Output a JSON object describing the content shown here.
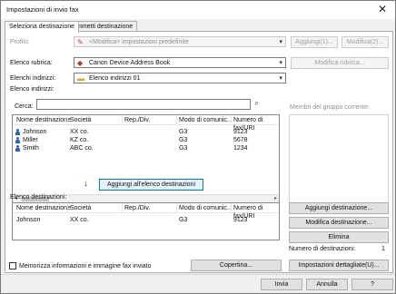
{
  "window": {
    "title": "Impostazioni di invio fax",
    "close_icon": "close-icon"
  },
  "tabs": [
    {
      "label": "Seleziona destinazione"
    },
    {
      "label": "Immetti destinazione"
    }
  ],
  "profile": {
    "label": "Profilo:",
    "value": "<Modifica> impostazioni predefinite",
    "add_button": "Aggiungi(1)...",
    "edit_button": "Modifica(2)..."
  },
  "address_book": {
    "label": "Elenco rubrica:",
    "value": "Canon Device Address Book",
    "edit_button": "Modifica rubrica..."
  },
  "address_list": {
    "label": "Elenchi indirizzi:",
    "value": "Elenco indirizzi 01"
  },
  "indices_label": "Elenco indirizzi:",
  "search": {
    "label": "Cerca:",
    "value": "",
    "icon": "search-icon"
  },
  "group_members_label": "Membri del gruppo corrente:",
  "address_table": {
    "columns": [
      "Nome destinazione",
      "Società",
      "Rep./Div.",
      "Modo di comunic...",
      "Numero di fax/URI"
    ],
    "rows": [
      [
        "Johnson",
        "XX co.",
        "",
        "G3",
        "9123"
      ],
      [
        "Miller",
        "KZ co.",
        "",
        "G3",
        "5678"
      ],
      [
        "Smith",
        "ABC co.",
        "",
        "G3",
        "1234"
      ]
    ]
  },
  "add_to_list_button": "Aggiungi all'elenco destinazioni",
  "destinations": {
    "label": "Elenco destinazioni:",
    "columns": [
      "Nome destinazione",
      "Società",
      "Rep./Div.",
      "Modo di comunic...",
      "Numero di fax/URI"
    ],
    "rows": [
      [
        "Johnson",
        "XX co.",
        "",
        "G3",
        "9123"
      ]
    ],
    "add_button": "Aggiungi destinazione...",
    "edit_button": "Modifica destinazione...",
    "delete_button": "Elimina",
    "count_label": "Numero di destinazioni:",
    "count_value": "1"
  },
  "store_checkbox_label": "Memorizza informazioni e immagine fax inviato",
  "cover_button": "Copertina...",
  "detail_button": "Impostazioni dettagliate(U)...",
  "footer": {
    "send": "Invia",
    "cancel": "Annulla",
    "help": "?"
  }
}
